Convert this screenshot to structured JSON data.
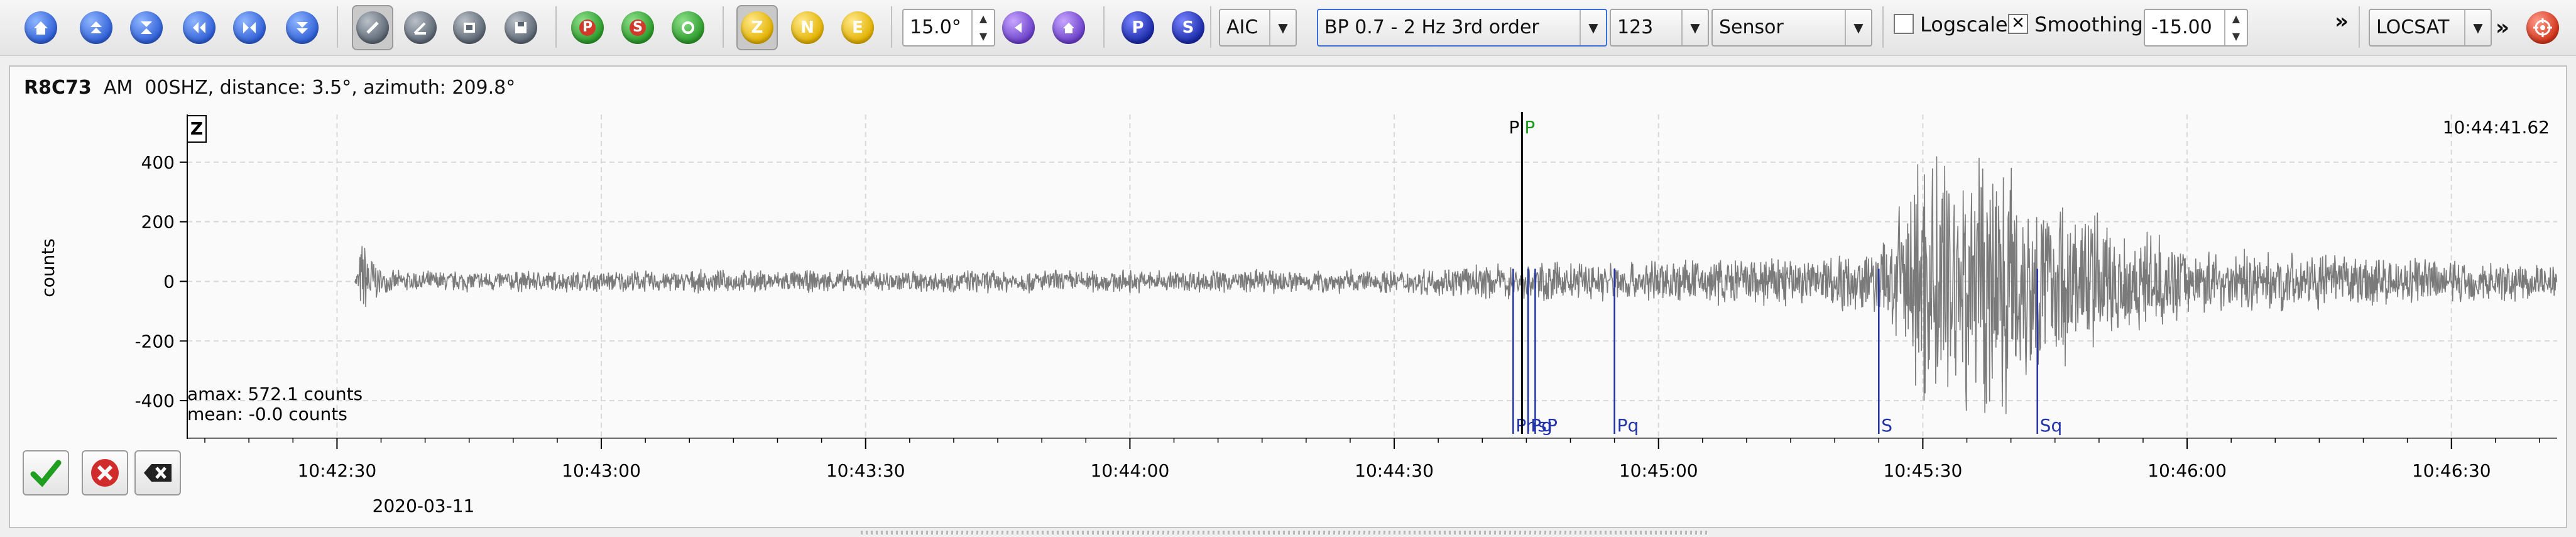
{
  "toolbar": {
    "nav_icons": [
      "home-icon",
      "scroll-up-icon",
      "collapse-icon",
      "scroll-left-icon",
      "fit-icon",
      "scroll-down-icon"
    ],
    "tool_icons": [
      "pick-tool-icon",
      "angle-tool-icon",
      "filter-tool-icon",
      "save-tool-icon"
    ],
    "phase_icons": [
      "p-phase-icon",
      "s-phase-icon",
      "auto-phase-icon"
    ],
    "components": [
      "Z",
      "N",
      "E"
    ],
    "slowness_value": "15.0°",
    "picker_method": "AIC",
    "filter": "BP 0.7 - 2 Hz  3rd order",
    "channel": "123",
    "unit": "Sensor",
    "logscale_label": "Logscale",
    "logscale_checked": false,
    "smoothing_label": "Smoothing",
    "smoothing_checked": true,
    "offset_value": "-15.00",
    "overflow": "»",
    "locator": "LOCSAT",
    "overflow2": "»",
    "p_label": "P",
    "s_label": "S",
    "colors": {
      "accent_blue": "#2f5fd6",
      "yellow": "#e2b100",
      "green": "#2b9a2a"
    }
  },
  "trace": {
    "station": "R8C73",
    "network": "AM",
    "channel": "00SHZ",
    "details": "distance: 3.5°, azimuth: 209.8°",
    "component_badge": "Z",
    "ylabel": "counts",
    "amax": "amax: 572.1 counts",
    "mean": "mean: -0.0 counts",
    "time_readout": "10:44:41.62",
    "date": "2020-03-11",
    "pick_markers": [
      {
        "label": "P",
        "color": "#000000"
      },
      {
        "label": "P",
        "color": "#1a9a1a"
      }
    ]
  },
  "chart_data": {
    "type": "line",
    "title": "",
    "xlabel": "",
    "ylabel": "counts",
    "yticks": [
      400,
      200,
      0,
      -200,
      -400
    ],
    "ylim": [
      -520,
      560
    ],
    "xticks": [
      "10:42:30",
      "10:43:00",
      "10:43:30",
      "10:44:00",
      "10:44:30",
      "10:45:00",
      "10:45:30",
      "10:46:00",
      "10:46:30"
    ],
    "x_start": "10:42:13",
    "x_end": "10:46:42",
    "phases": [
      {
        "label": "Pn",
        "time": "10:44:43.5"
      },
      {
        "label": "Pg",
        "time": "10:44:45.2"
      },
      {
        "label": "sP",
        "time": "10:44:46.0"
      },
      {
        "label": "Pq",
        "time": "10:44:55.0"
      },
      {
        "label": "S",
        "time": "10:45:25.0"
      },
      {
        "label": "Sq",
        "time": "10:45:43.0"
      }
    ],
    "current_pick_time": "10:44:44.5",
    "envelope": [
      {
        "t": "10:42:13",
        "amp": 0
      },
      {
        "t": "10:42:32",
        "amp": 0
      },
      {
        "t": "10:42:33",
        "amp": 180
      },
      {
        "t": "10:42:35",
        "amp": 40
      },
      {
        "t": "10:44:30",
        "amp": 45
      },
      {
        "t": "10:44:45",
        "amp": 70
      },
      {
        "t": "10:45:10",
        "amp": 90
      },
      {
        "t": "10:45:25",
        "amp": 120
      },
      {
        "t": "10:45:30",
        "amp": 480
      },
      {
        "t": "10:45:36",
        "amp": 560
      },
      {
        "t": "10:45:45",
        "amp": 320
      },
      {
        "t": "10:46:00",
        "amp": 120
      },
      {
        "t": "10:46:42",
        "amp": 70
      }
    ]
  },
  "actions": [
    "accept-icon",
    "cancel-icon",
    "clear-icon"
  ]
}
